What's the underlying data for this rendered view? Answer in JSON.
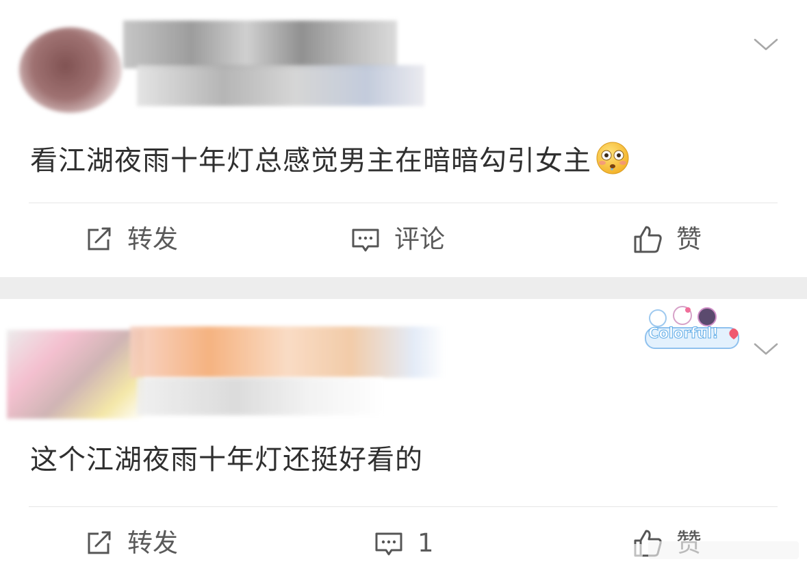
{
  "posts": [
    {
      "text": "看江湖夜雨十年灯总感觉男主在暗暗勾引女主",
      "emoji": "flushed-face",
      "actions": {
        "repost": "转发",
        "comment": "评论",
        "like": "赞"
      }
    },
    {
      "text": "这个江湖夜雨十年灯还挺好看的",
      "badge": "Colorful!",
      "actions": {
        "repost": "转发",
        "comment": "1",
        "like": "赞"
      }
    }
  ],
  "colors": {
    "text": "#2f2f2f",
    "action": "#5a5a5a",
    "separator": "#ededed",
    "divider": "#e6e6e6"
  }
}
